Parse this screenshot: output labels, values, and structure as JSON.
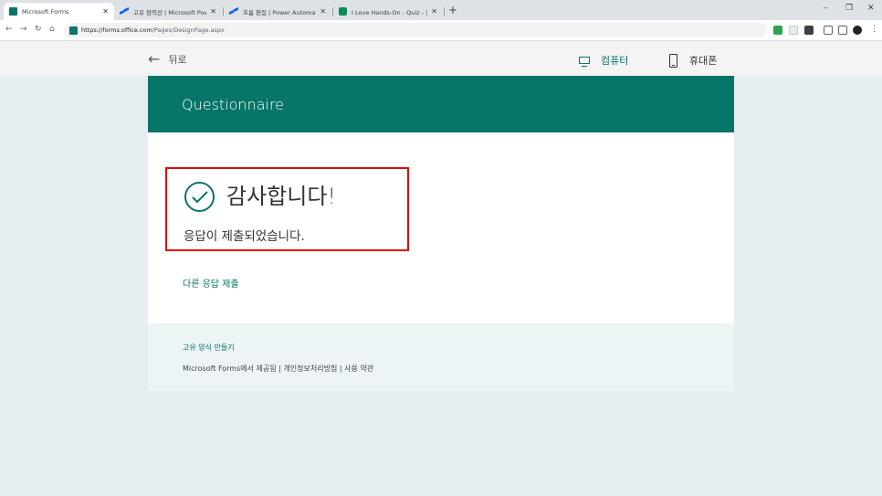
{
  "browser": {
    "tabs": [
      {
        "title": "Microsoft Forms",
        "favicon": "forms-icon",
        "active": true
      },
      {
        "title": "고유 협력선 | Microsoft Power A",
        "favicon": "power-automate-icon",
        "active": false
      },
      {
        "title": "흐름 편집 | Power Automate",
        "favicon": "power-automate-icon",
        "active": false
      },
      {
        "title": "I Love Hands-On - Quiz - 응든",
        "favicon": "forms-icon",
        "active": false
      }
    ],
    "new_tab": "+",
    "window_controls": {
      "minimize": "–",
      "maximize": "❐",
      "close": "✕"
    },
    "url_host": "https://forms.office.com",
    "url_path": "/Pages/DesignPage.aspx"
  },
  "forms_bar": {
    "back_label": "뒤로",
    "computer_label": "컴퓨터",
    "phone_label": "휴대폰",
    "accent_color": "#077568"
  },
  "form": {
    "title": "Questionnaire",
    "thanks_text": "감사합니다!",
    "submitted_text": "응답이 제출되었습니다.",
    "submit_another": "다른 응답 제출",
    "highlight_color": "#e00b0b"
  },
  "footer": {
    "make_own": "고유 양식 만들기",
    "powered_by": "Microsoft Forms에서 제공됨",
    "separator": "|",
    "privacy": "개인정보처리방침",
    "terms": "사용 약관"
  }
}
